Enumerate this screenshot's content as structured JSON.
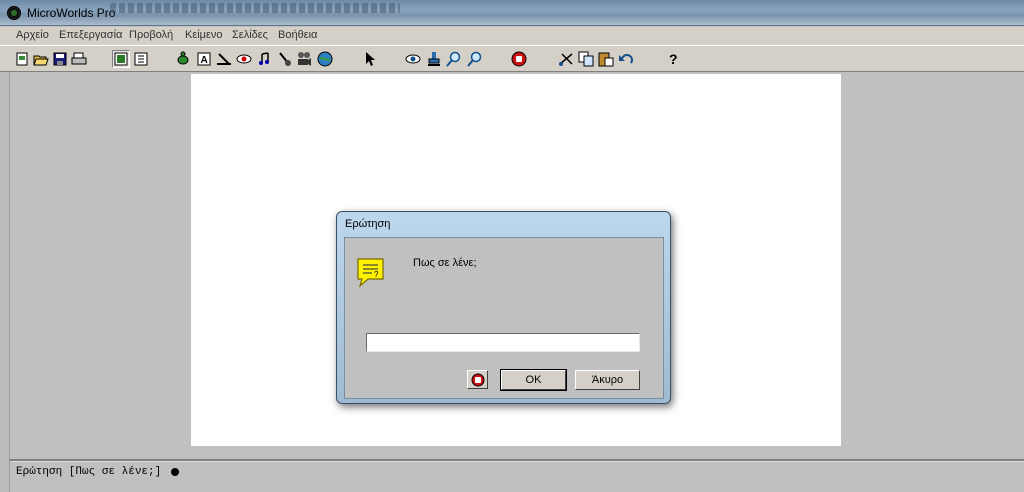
{
  "window": {
    "title": "MicroWorlds Pro"
  },
  "menu": [
    "Αρχείο",
    "Επεξεργασία",
    "Προβολή",
    "Κείμενο",
    "Σελίδες",
    "Βοήθεια"
  ],
  "toolbar_icons": [
    "new-page-icon",
    "open-icon",
    "save-icon",
    "print-icon",
    "procedures-view-icon",
    "project-view-icon",
    "new-turtle-icon",
    "new-text-icon",
    "new-slider-icon",
    "new-button-icon",
    "new-melody-icon",
    "new-sound-icon",
    "new-video-icon",
    "new-graphics-icon",
    "select-pointer-icon",
    "eye-icon",
    "stamp-icon",
    "zoom-in-icon",
    "zoom-out-icon",
    "stop-all-icon",
    "cut-icon",
    "copy-icon",
    "paste-icon",
    "undo-icon",
    "help-icon"
  ],
  "dialog": {
    "title": "Ερώτηση",
    "prompt": "Πως σε λένε;",
    "answer_value": "",
    "ok_label": "OK",
    "cancel_label": "Άκυρο"
  },
  "command_center": {
    "text": "Ερώτηση [Πως σε λένε;]"
  },
  "colors": {
    "page": "#ffffff",
    "workspace": "#c0c0c0",
    "prompt_icon": "#fff200",
    "stop": "#cc1111"
  }
}
